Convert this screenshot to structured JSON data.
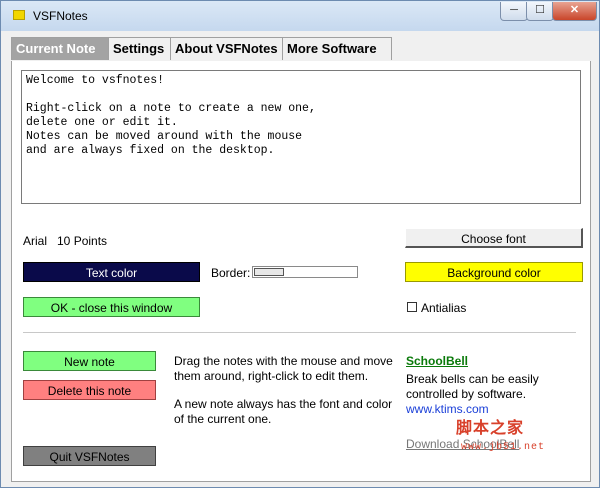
{
  "window": {
    "title": "VSFNotes",
    "minimize_label": "─",
    "maximize_label": "☐",
    "close_label": "✕"
  },
  "tabs": [
    {
      "label": "Current Note",
      "active": true
    },
    {
      "label": "Settings",
      "active": false
    },
    {
      "label": "About VSFNotes",
      "active": false
    },
    {
      "label": "More Software",
      "active": false
    }
  ],
  "note": {
    "text": "Welcome to vsfnotes!\n\nRight-click on a note to create a new one,\ndelete one or edit it.\nNotes can be moved around with the mouse\nand are always fixed on the desktop."
  },
  "font": {
    "label": "Arial   10 Points",
    "choose_label": "Choose font"
  },
  "colors": {
    "text_color_label": "Text color",
    "text_color_value": "#0a0a4a",
    "background_color_label": "Background color",
    "background_color_value": "#ffff00"
  },
  "border": {
    "label": "Border:"
  },
  "ok_button": {
    "label": "OK - close this window",
    "color": "#80ff80"
  },
  "antialias": {
    "label": "Antialias",
    "checked": false
  },
  "actions": {
    "new_note": {
      "label": "New note",
      "color": "#80ff80"
    },
    "delete_note": {
      "label": "Delete this note",
      "color": "#ff8080"
    },
    "quit": {
      "label": "Quit VSFNotes",
      "color": "#808080"
    }
  },
  "help": {
    "drag": "Drag the notes with the mouse and move them around, right-click to edit them.",
    "new_note_info": "A new note always has the font and color of the current one."
  },
  "ad": {
    "title": "SchoolBell",
    "description": "Break bells can be easily controlled by software.",
    "url": "www.ktims.com",
    "download": "Download SchoolBell"
  },
  "watermark": {
    "text": "脚本之家",
    "url": "www.jb51.net"
  }
}
